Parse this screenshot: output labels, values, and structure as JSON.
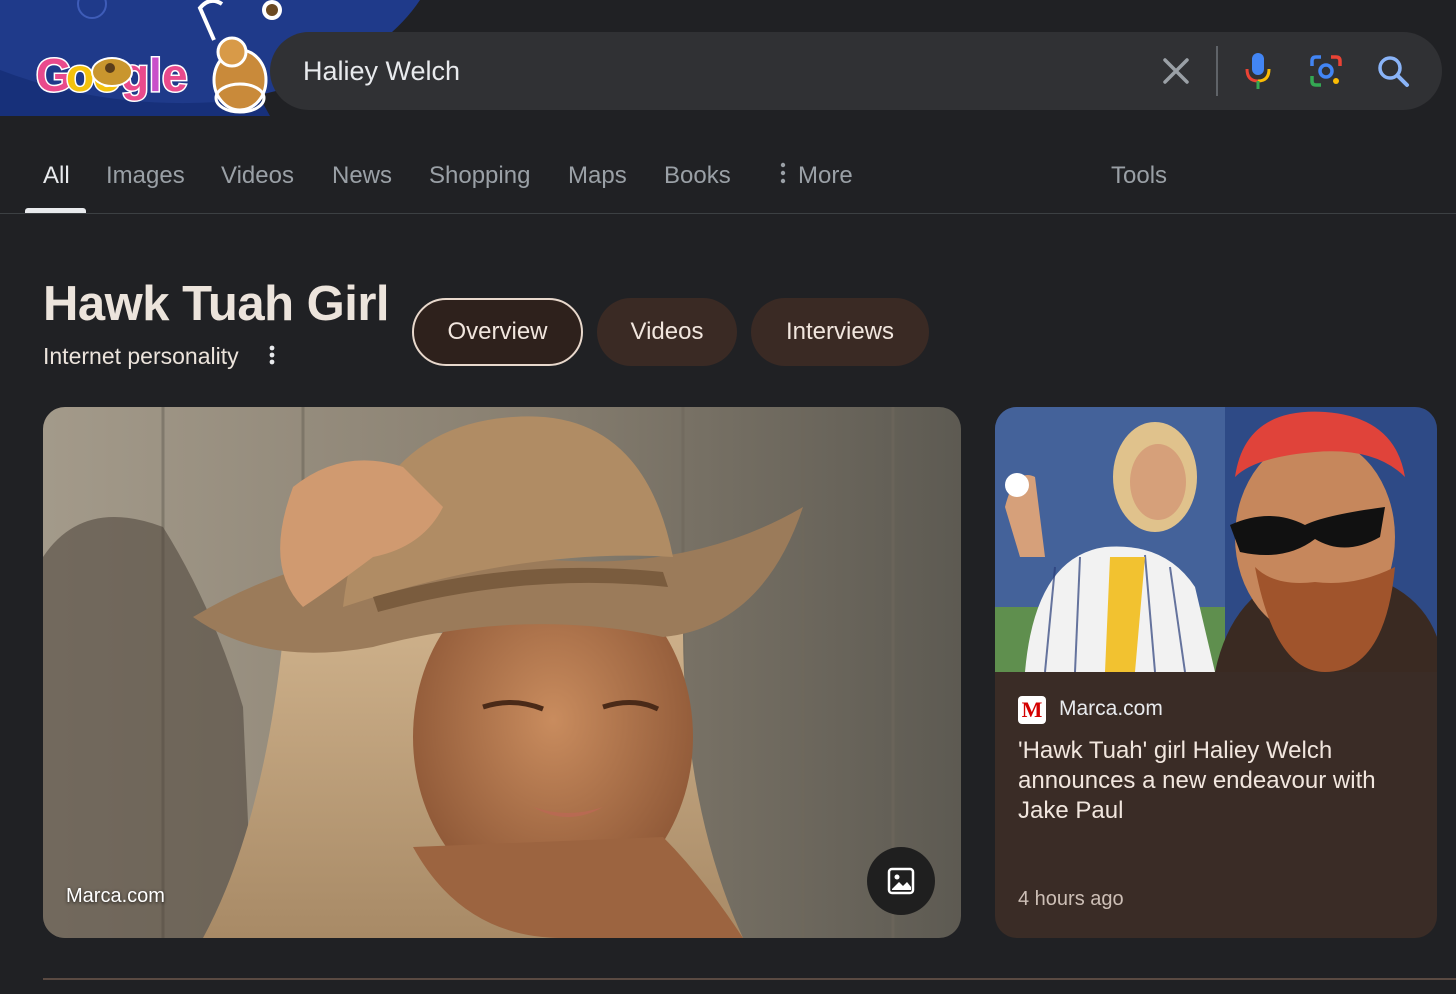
{
  "search": {
    "query": "Haliey Welch",
    "clear_icon": "close-icon",
    "voice_icon": "mic-icon",
    "lens_icon": "lens-icon",
    "search_icon": "search-icon"
  },
  "logo": {
    "text": "Google",
    "doodle": true
  },
  "tabs": [
    {
      "label": "All",
      "active": true
    },
    {
      "label": "Images"
    },
    {
      "label": "Videos"
    },
    {
      "label": "News"
    },
    {
      "label": "Shopping"
    },
    {
      "label": "Maps"
    },
    {
      "label": "Books"
    },
    {
      "label": "More",
      "icon": "kebab-icon"
    }
  ],
  "tools_label": "Tools",
  "entity": {
    "title": "Hawk Tuah Girl",
    "subtitle": "Internet personality",
    "chips": [
      {
        "label": "Overview",
        "selected": true
      },
      {
        "label": "Videos"
      },
      {
        "label": "Interviews"
      }
    ]
  },
  "main_image": {
    "source": "Marca.com",
    "button_icon": "image-icon"
  },
  "news_card": {
    "source": "Marca.com",
    "source_logo_letter": "M",
    "headline": "'Hawk Tuah' girl Haliey Welch announces a new endeavour with Jake Paul",
    "time": "4 hours ago"
  },
  "colors": {
    "background": "#202124",
    "search_bg": "#303134",
    "chip_bg": "#3a2a24",
    "card_bg": "#3a2c26",
    "marca_red": "#d40000"
  }
}
